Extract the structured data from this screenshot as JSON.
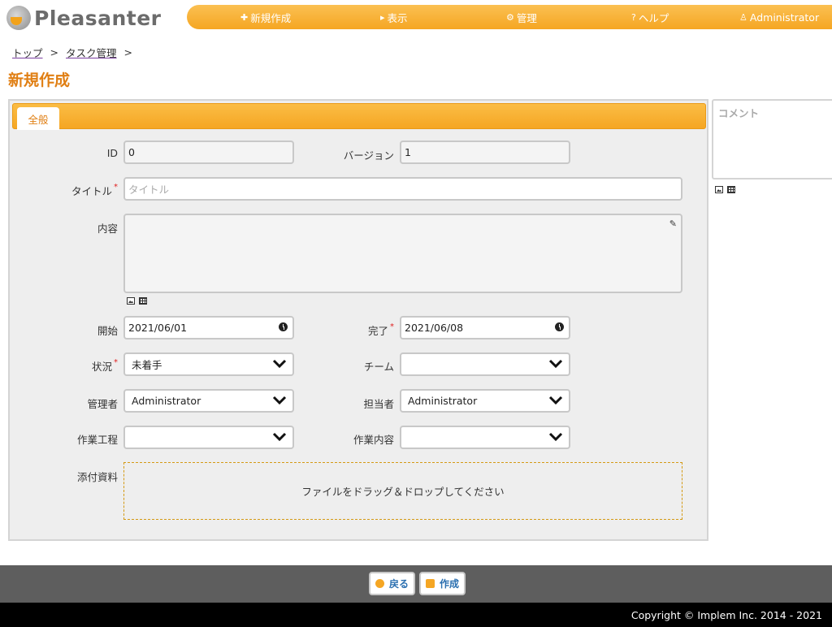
{
  "app": {
    "logo_text": "Pleasanter"
  },
  "nav": {
    "new": "新規作成",
    "view": "表示",
    "manage": "管理",
    "help": "ヘルプ",
    "user": "Administrator"
  },
  "breadcrumb": {
    "top": "トップ",
    "task": "タスク管理",
    "sep": ">"
  },
  "page": {
    "title": "新規作成"
  },
  "tabs": {
    "general": "全般"
  },
  "form": {
    "id": {
      "label": "ID",
      "value": "0"
    },
    "version": {
      "label": "バージョン",
      "value": "1"
    },
    "title": {
      "label": "タイトル",
      "placeholder": "タイトル"
    },
    "body": {
      "label": "内容"
    },
    "start": {
      "label": "開始",
      "value": "2021/06/01"
    },
    "complete": {
      "label": "完了",
      "value": "2021/06/08"
    },
    "status": {
      "label": "状況",
      "value": "未着手"
    },
    "team": {
      "label": "チーム",
      "value": ""
    },
    "manager": {
      "label": "管理者",
      "value": "Administrator"
    },
    "owner": {
      "label": "担当者",
      "value": "Administrator"
    },
    "process": {
      "label": "作業工程",
      "value": ""
    },
    "work_content": {
      "label": "作業内容",
      "value": ""
    },
    "attachments": {
      "label": "添付資料",
      "drop_text": "ファイルをドラッグ＆ドロップしてください"
    },
    "required_mark": "*"
  },
  "comment": {
    "placeholder": "コメント"
  },
  "actions": {
    "back": "戻る",
    "create": "作成"
  },
  "footer": {
    "copyright": "Copyright © Implem Inc. 2014 - 2021"
  },
  "colors": {
    "accent": "#f5a623",
    "title": "#e07f14",
    "link": "#2a6fb0"
  }
}
